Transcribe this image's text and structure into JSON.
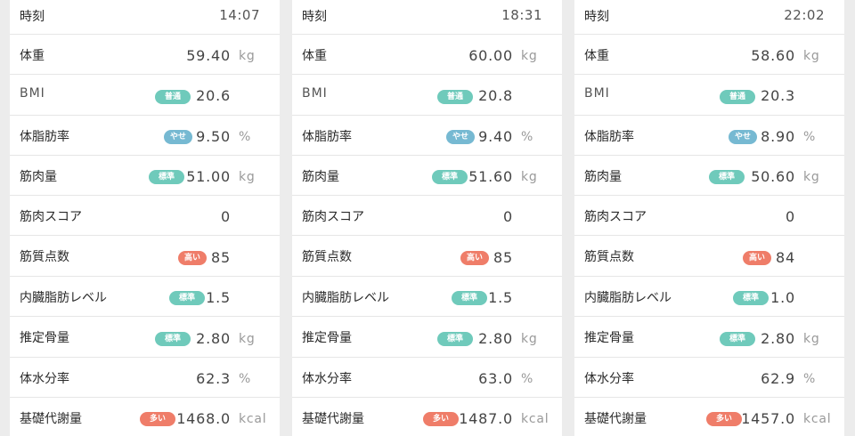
{
  "colors": {
    "normal": "#6fcabb",
    "thin": "#76b9d2",
    "high": "#ef7d69"
  },
  "labels": {
    "time": "時刻",
    "weight": "体重",
    "bmi": "BMI",
    "body_fat": "体脂肪率",
    "muscle": "筋肉量",
    "muscle_score": "筋肉スコア",
    "muscle_quality": "筋質点数",
    "visceral_fat": "内臓脂肪レベル",
    "bone": "推定骨量",
    "water": "体水分率",
    "bmr": "基礎代謝量"
  },
  "records": [
    {
      "time": "14:07",
      "weight": {
        "value": "59.40",
        "unit": "kg"
      },
      "bmi": {
        "value": "20.6",
        "badge": "普通"
      },
      "body_fat": {
        "value": "9.50",
        "unit": "%",
        "badge": "やせ"
      },
      "muscle": {
        "value": "51.00",
        "unit": "kg",
        "badge": "標準"
      },
      "muscle_score": {
        "value": "0"
      },
      "muscle_quality": {
        "value": "85",
        "badge": "高い"
      },
      "visceral_fat": {
        "value": "1.5",
        "badge": "標準"
      },
      "bone": {
        "value": "2.80",
        "unit": "kg",
        "badge": "標準"
      },
      "water": {
        "value": "62.3",
        "unit": "%"
      },
      "bmr": {
        "value": "1468.0",
        "unit": "kcal",
        "badge": "多い"
      }
    },
    {
      "time": "18:31",
      "weight": {
        "value": "60.00",
        "unit": "kg"
      },
      "bmi": {
        "value": "20.8",
        "badge": "普通"
      },
      "body_fat": {
        "value": "9.40",
        "unit": "%",
        "badge": "やせ"
      },
      "muscle": {
        "value": "51.60",
        "unit": "kg",
        "badge": "標準"
      },
      "muscle_score": {
        "value": "0"
      },
      "muscle_quality": {
        "value": "85",
        "badge": "高い"
      },
      "visceral_fat": {
        "value": "1.5",
        "badge": "標準"
      },
      "bone": {
        "value": "2.80",
        "unit": "kg",
        "badge": "標準"
      },
      "water": {
        "value": "63.0",
        "unit": "%"
      },
      "bmr": {
        "value": "1487.0",
        "unit": "kcal",
        "badge": "多い"
      }
    },
    {
      "time": "22:02",
      "weight": {
        "value": "58.60",
        "unit": "kg"
      },
      "bmi": {
        "value": "20.3",
        "badge": "普通"
      },
      "body_fat": {
        "value": "8.90",
        "unit": "%",
        "badge": "やせ"
      },
      "muscle": {
        "value": "50.60",
        "unit": "kg",
        "badge": "標準"
      },
      "muscle_score": {
        "value": "0"
      },
      "muscle_quality": {
        "value": "84",
        "badge": "高い"
      },
      "visceral_fat": {
        "value": "1.0",
        "badge": "標準"
      },
      "bone": {
        "value": "2.80",
        "unit": "kg",
        "badge": "標準"
      },
      "water": {
        "value": "62.9",
        "unit": "%"
      },
      "bmr": {
        "value": "1457.0",
        "unit": "kcal",
        "badge": "多い"
      }
    }
  ]
}
